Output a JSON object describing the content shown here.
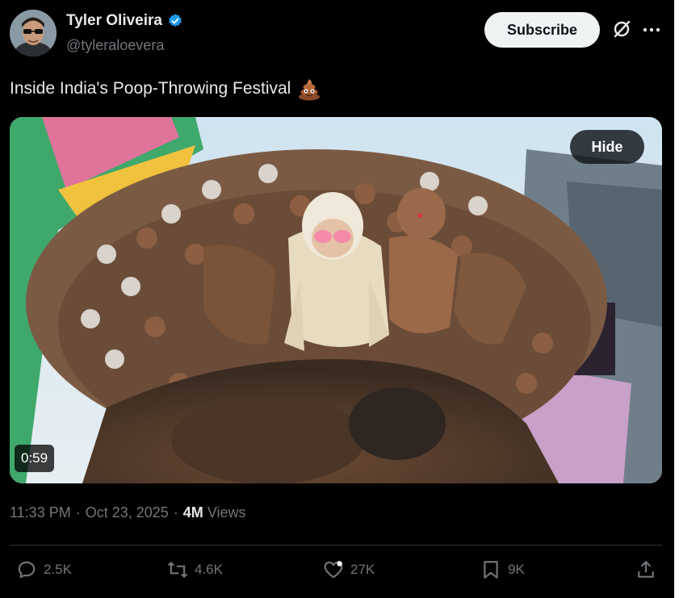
{
  "author": {
    "display_name": "Tyler Oliveira",
    "handle": "@tyleraloevera",
    "verified": true,
    "avatar_icon": "avatar-with-sunglasses"
  },
  "header": {
    "subscribe_label": "Subscribe",
    "grok_icon": "slashed-circle-icon",
    "more_icon": "more-dots-icon"
  },
  "tweet": {
    "text": "Inside India's Poop-Throwing Festival",
    "emoji_icon": "poop-emoji-icon"
  },
  "media": {
    "hide_label": "Hide",
    "duration": "0:59"
  },
  "meta": {
    "time": "11:33 PM",
    "separator": "·",
    "date": "Oct 23, 2025",
    "views_count": "4M",
    "views_label": "Views"
  },
  "actions": {
    "replies": "2.5K",
    "reposts": "4.6K",
    "likes": "27K",
    "bookmarks": "9K"
  },
  "colors": {
    "background": "#000000",
    "text": "#e7e9ea",
    "secondary": "#71767b",
    "verified": "#1d9bf0",
    "subscribe_bg": "#eff3f4"
  }
}
